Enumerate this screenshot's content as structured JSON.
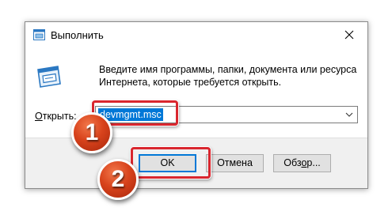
{
  "window": {
    "title": "Выполнить",
    "close_icon": "close-icon",
    "app_icon": "run-dialog-icon"
  },
  "prompt": {
    "line1": "Введите имя программы, папки, документа или ресурса",
    "line2": "Интернета, которые требуется открыть."
  },
  "open_field": {
    "label_underlined": "О",
    "label_rest": "ткрыть:",
    "value": "devmgmt.msc"
  },
  "buttons": {
    "ok": "OK",
    "cancel": "Отмена",
    "browse_prefix": "Обз",
    "browse_underlined": "о",
    "browse_suffix": "р..."
  },
  "annotations": {
    "step1": "1",
    "step2": "2",
    "highlight_color": "#d9262e",
    "badge_color": "#d8431c"
  },
  "colors": {
    "selection": "#0078d7",
    "footer_bg": "#f0f0f0"
  }
}
